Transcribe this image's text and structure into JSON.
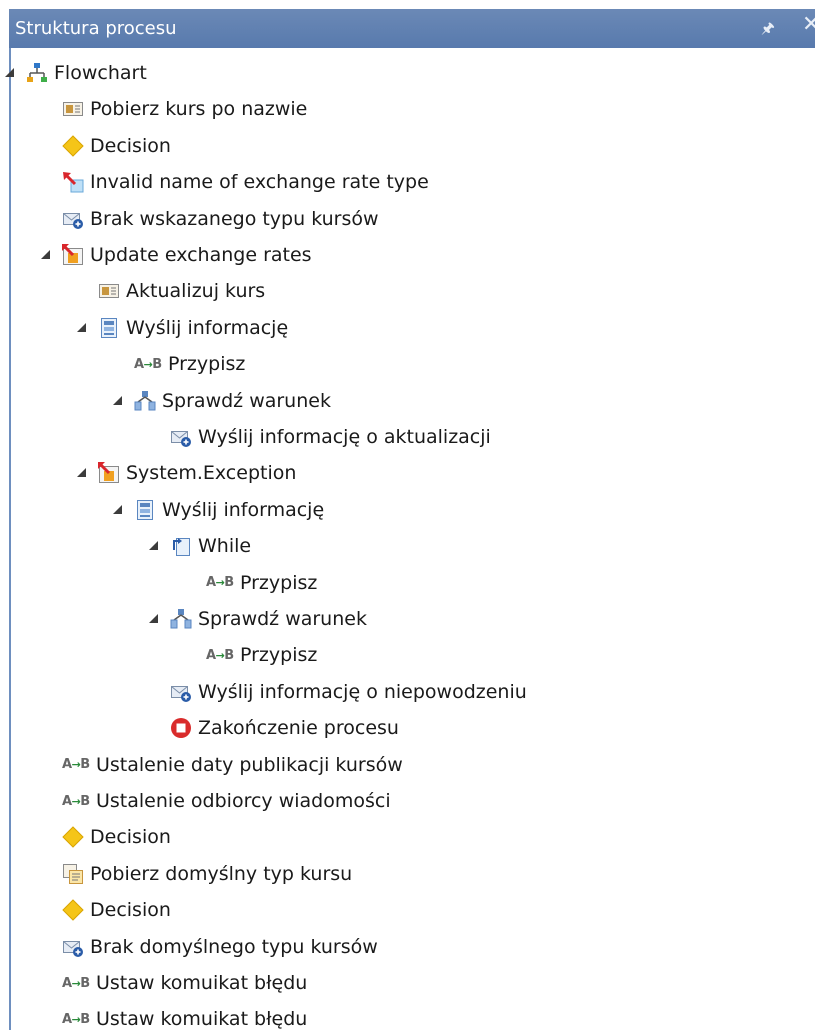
{
  "panel": {
    "title": "Struktura procesu"
  },
  "icons": {
    "pin": "pin-icon",
    "close": "close-icon",
    "expanded": "expanded-triangle-icon"
  },
  "colors": {
    "title_bar": "#587aad",
    "decision": "#f5c518",
    "terminate": "#d92b2b"
  },
  "tree": [
    {
      "label": "Flowchart",
      "icon": "flowchart-icon",
      "expanded": true
    },
    {
      "label": "Pobierz kurs po nazwie",
      "icon": "activity-icon"
    },
    {
      "label": "Decision",
      "icon": "decision-icon"
    },
    {
      "label": "Invalid name of exchange rate type",
      "icon": "throw-icon"
    },
    {
      "label": "Brak wskazanego typu kursów",
      "icon": "send-mail-icon"
    },
    {
      "label": "Update exchange rates",
      "icon": "trycatch-icon",
      "expanded": true
    },
    {
      "label": "Aktualizuj kurs",
      "icon": "activity-icon"
    },
    {
      "label": "Wyślij informację",
      "icon": "sequence-icon",
      "expanded": true
    },
    {
      "label": "Przypisz",
      "icon": "assign-icon"
    },
    {
      "label": "Sprawdź warunek",
      "icon": "if-icon",
      "expanded": true
    },
    {
      "label": "Wyślij informację o aktualizacji",
      "icon": "send-mail-icon"
    },
    {
      "label": "System.Exception",
      "icon": "trycatch-icon",
      "expanded": true
    },
    {
      "label": "Wyślij informację",
      "icon": "sequence-icon",
      "expanded": true
    },
    {
      "label": "While",
      "icon": "while-icon",
      "expanded": true
    },
    {
      "label": "Przypisz",
      "icon": "assign-icon"
    },
    {
      "label": "Sprawdź warunek",
      "icon": "if-icon",
      "expanded": true
    },
    {
      "label": "Przypisz",
      "icon": "assign-icon"
    },
    {
      "label": "Wyślij informację o niepowodzeniu",
      "icon": "send-mail-icon"
    },
    {
      "label": "Zakończenie procesu",
      "icon": "terminate-icon"
    },
    {
      "label": "Ustalenie daty publikacji kursów",
      "icon": "assign-icon"
    },
    {
      "label": "Ustalenie odbiorcy wiadomości",
      "icon": "assign-icon"
    },
    {
      "label": "Decision",
      "icon": "decision-icon"
    },
    {
      "label": "Pobierz domyślny typ kursu",
      "icon": "invoke-icon"
    },
    {
      "label": "Decision",
      "icon": "decision-icon"
    },
    {
      "label": "Brak domyślnego typu kursów",
      "icon": "send-mail-icon"
    },
    {
      "label": "Ustaw komuikat błędu",
      "icon": "assign-icon"
    },
    {
      "label": "Ustaw komuikat błędu",
      "icon": "assign-icon"
    }
  ]
}
